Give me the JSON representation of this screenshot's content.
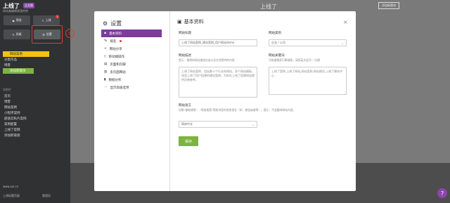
{
  "sidebar": {
    "brand": "上线了",
    "brand_badge": "企业版",
    "brand_sub": "网站美编辑我我的吧",
    "buttons": [
      {
        "label": "预览",
        "icon": "eye-icon"
      },
      {
        "label": "上线",
        "icon": "upload-icon"
      },
      {
        "label": "风格",
        "icon": "brush-icon"
      },
      {
        "label": "设置",
        "icon": "gear-icon"
      }
    ],
    "notify_count": "1",
    "step_marker": "①",
    "items": [
      "网站案例",
      "分类作品",
      "博客",
      "添加新版块"
    ],
    "section_heading": "导航栏",
    "nav_items": [
      "首页",
      "博客",
      "网站案例",
      "小程序案例",
      "颜值云私片案例",
      "案例配置",
      "上线了官网",
      "添加新链接"
    ],
    "footer_domain": "www.sxl.cn",
    "footer_left": "上线标题页面",
    "footer_right": "管理员"
  },
  "background": {
    "title": "上线了",
    "button": "添加新版块",
    "help": "?"
  },
  "modal": {
    "title": "设置",
    "menu": [
      {
        "label": "基本资料",
        "icon": "pin-icon",
        "active": true
      },
      {
        "label": "域名",
        "icon": "link-icon",
        "dot": true
      },
      {
        "label": "网站分享",
        "icon": "share-icon"
      },
      {
        "label": "移动端操作",
        "icon": "mobile-icon"
      },
      {
        "label": "页面和页脚",
        "icon": "page-icon"
      },
      {
        "label": "多页面网站",
        "icon": "pages-icon"
      },
      {
        "label": "数据分析",
        "icon": "chart-icon"
      },
      {
        "label": "显示高级选项",
        "icon": "dots-icon"
      }
    ],
    "heading": "基本资料",
    "site_title_label": "网站标题",
    "site_title_value": "上线了网站案例_建站案例_用户网站demo",
    "site_type_label": "网站类别",
    "site_type_value": "企业 / 公司",
    "site_desc_label": "网站描述",
    "site_desc_hint": "提示：理想的网站描述应该以及它所提供的内容",
    "site_desc_value": "上线了网站案例，包括数十个行业的网站，多个网站模板，浏览上线了用户搭建的建站案例。为你在上线了搭建网站提供灵感参考。",
    "site_kw_label": "网站关键词",
    "site_kw_hint": "可依据搜索引擎搜索，请用英文逗号\",\"分隔",
    "site_kw_value": "上线了案例,上线了网站,网站案例,网站建设,上线了建站中心",
    "site_lang_label": "网站语言",
    "site_lang_hint": "切换\"基础博客\"、\"简易搜索\"等版块里的系统语言（如：按钮或者等）。提示：不会翻译网站内容。",
    "site_lang_value": "简体中文",
    "save_label": "保存",
    "close": "×"
  }
}
